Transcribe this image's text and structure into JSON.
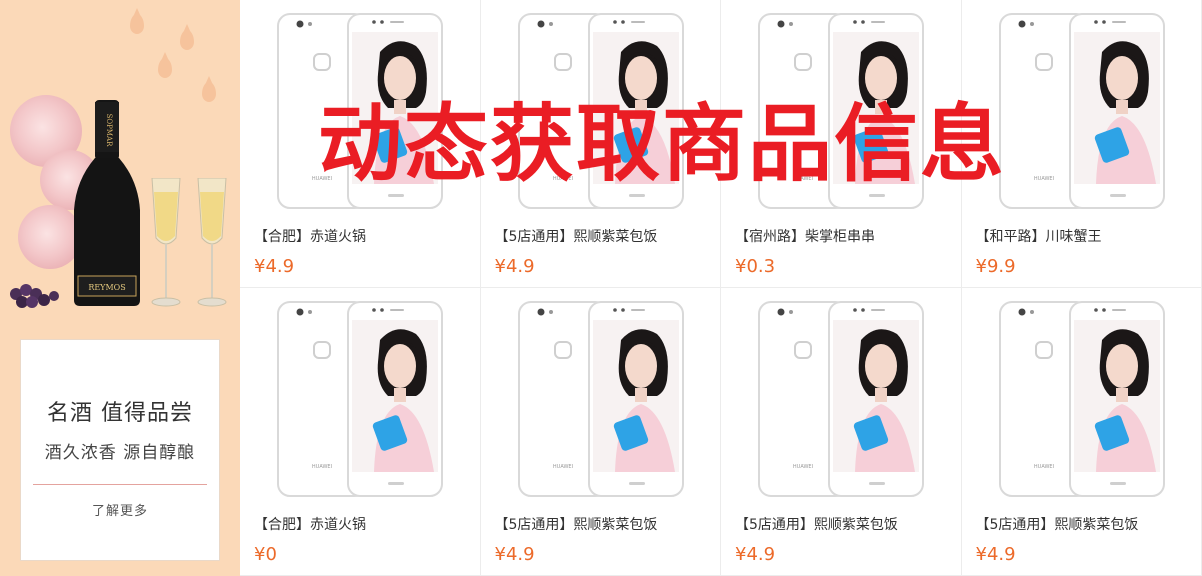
{
  "banner": {
    "line1": "名酒 值得品尝",
    "line2": "酒久浓香 源自醇酿",
    "more": "了解更多",
    "bottle_label": "REYMOS",
    "bottle_neck_text": "SOPMAR"
  },
  "overlay_text": "动态获取商品信息",
  "products": [
    {
      "title": "【合肥】赤道火锅",
      "price": "¥4.9"
    },
    {
      "title": "【5店通用】熙顺紫菜包饭",
      "price": "¥4.9"
    },
    {
      "title": "【宿州路】柴掌柜串串",
      "price": "¥0.3"
    },
    {
      "title": "【和平路】川味蟹王",
      "price": "¥9.9"
    },
    {
      "title": "【合肥】赤道火锅",
      "price": "¥0"
    },
    {
      "title": "【5店通用】熙顺紫菜包饭",
      "price": "¥4.9"
    },
    {
      "title": "【5店通用】熙顺紫菜包饭",
      "price": "¥4.9"
    },
    {
      "title": "【5店通用】熙顺紫菜包饭",
      "price": "¥4.9"
    }
  ],
  "phone_brand": "HUAWEI",
  "colors": {
    "price": "#ec6a2a",
    "overlay": "#ea1d24",
    "banner_bg": "#fbd9b8"
  }
}
